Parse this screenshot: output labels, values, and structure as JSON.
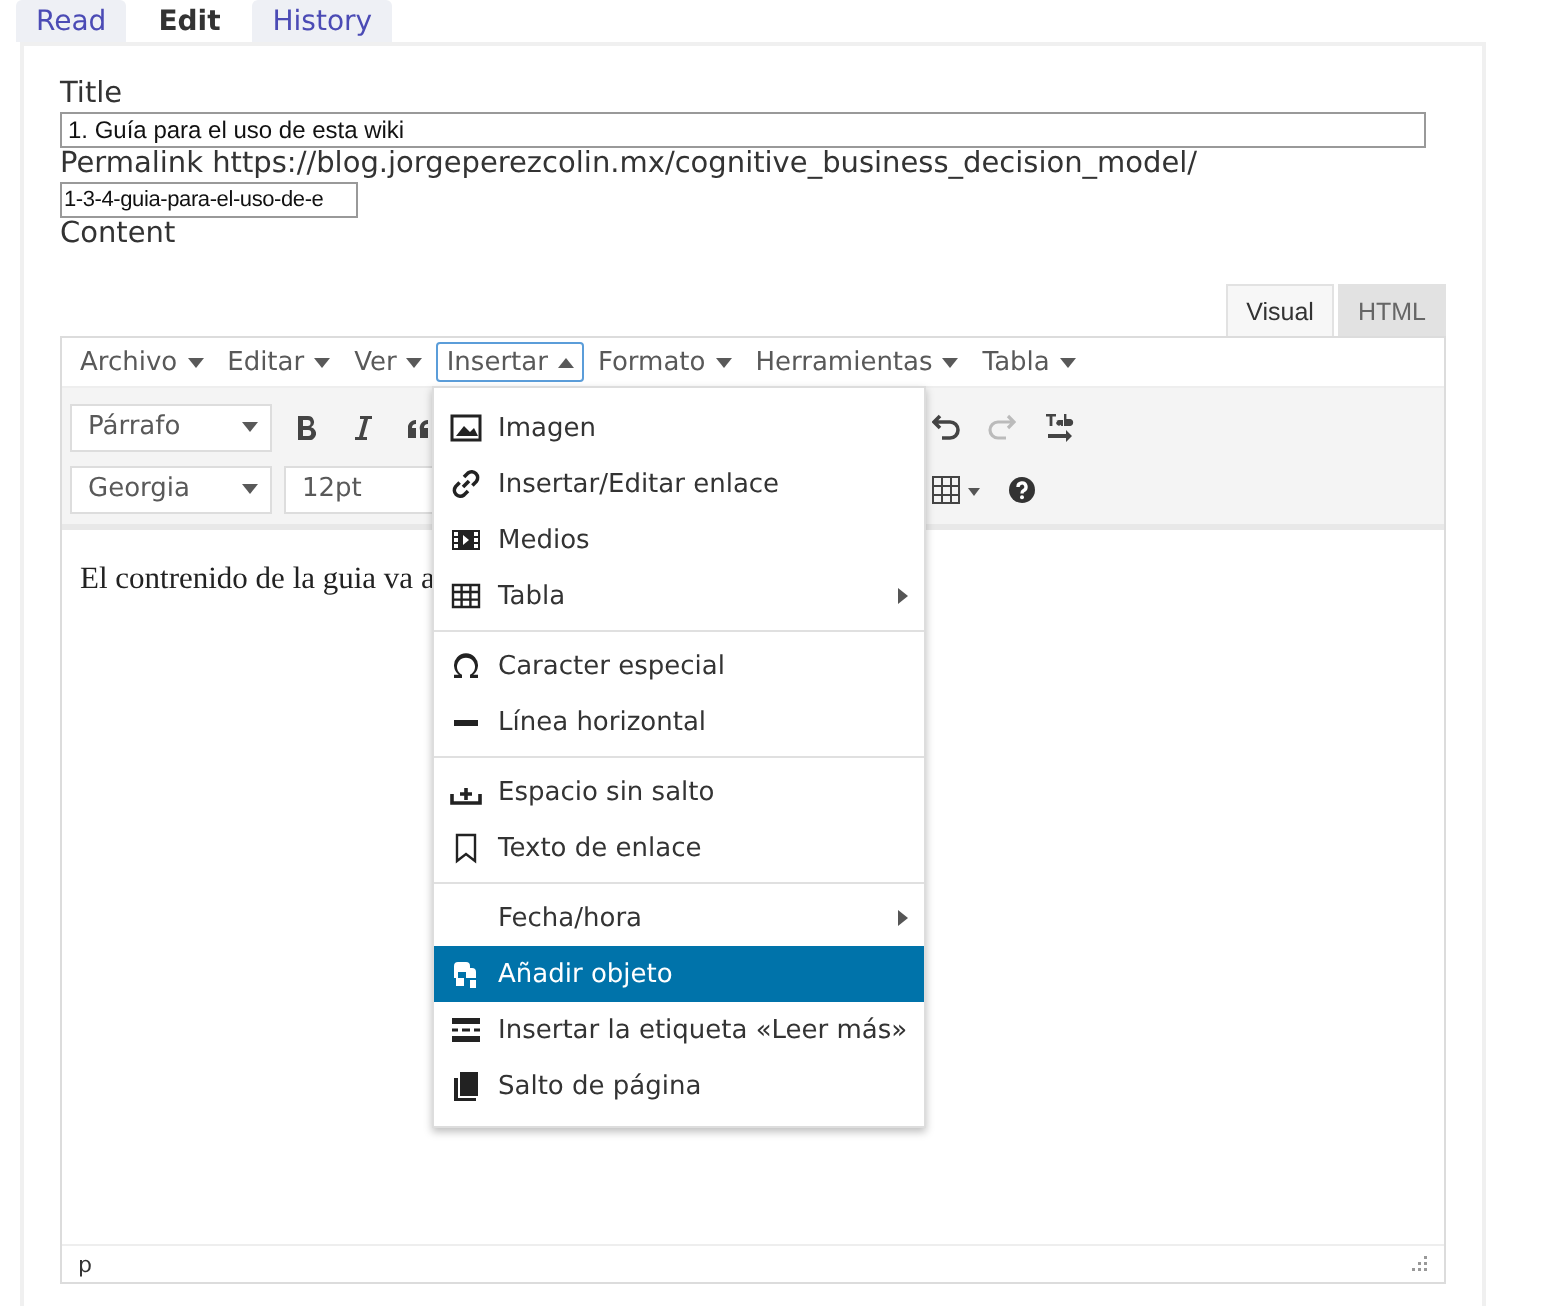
{
  "page_tabs": [
    {
      "label": "Read",
      "selected": false
    },
    {
      "label": "Edit",
      "selected": true
    },
    {
      "label": "History",
      "selected": false
    }
  ],
  "form": {
    "title_label": "Title",
    "title_value": "1. Guía para el uso de esta wiki",
    "permalink_label": "Permalink https://blog.jorgeperezcolin.mx/cognitive_business_decision_model/",
    "slug_value": "1-3-4-guia-para-el-uso-de-e",
    "content_label": "Content"
  },
  "editor": {
    "mode_tabs": [
      {
        "label": "Visual",
        "selected": true
      },
      {
        "label": "HTML",
        "selected": false
      }
    ],
    "menubar": [
      {
        "label": "Archivo",
        "open": false
      },
      {
        "label": "Editar",
        "open": false
      },
      {
        "label": "Ver",
        "open": false
      },
      {
        "label": "Insertar",
        "open": true
      },
      {
        "label": "Formato",
        "open": false
      },
      {
        "label": "Herramientas",
        "open": false
      },
      {
        "label": "Tabla",
        "open": false
      }
    ],
    "block_format": "Párrafo",
    "font_family": "Georgia",
    "font_size": "12pt",
    "content_text": "El contrenido de la guia va a",
    "status_path": "p"
  },
  "insert_menu": {
    "groups": [
      [
        {
          "label": "Imagen",
          "selected": false,
          "submenu": false
        },
        {
          "label": "Insertar/Editar enlace",
          "selected": false,
          "submenu": false
        },
        {
          "label": "Medios",
          "selected": false,
          "submenu": false
        },
        {
          "label": "Tabla",
          "selected": false,
          "submenu": true
        }
      ],
      [
        {
          "label": "Caracter especial",
          "selected": false,
          "submenu": false
        },
        {
          "label": "Línea horizontal",
          "selected": false,
          "submenu": false
        }
      ],
      [
        {
          "label": "Espacio sin salto",
          "selected": false,
          "submenu": false
        },
        {
          "label": "Texto de enlace",
          "selected": false,
          "submenu": false
        }
      ],
      [
        {
          "label": "Fecha/hora",
          "selected": false,
          "submenu": true
        },
        {
          "label": "Añadir objeto",
          "selected": true,
          "submenu": false
        },
        {
          "label": "Insertar la etiqueta «Leer más»",
          "selected": false,
          "submenu": false
        },
        {
          "label": "Salto de página",
          "selected": false,
          "submenu": false
        }
      ]
    ]
  }
}
